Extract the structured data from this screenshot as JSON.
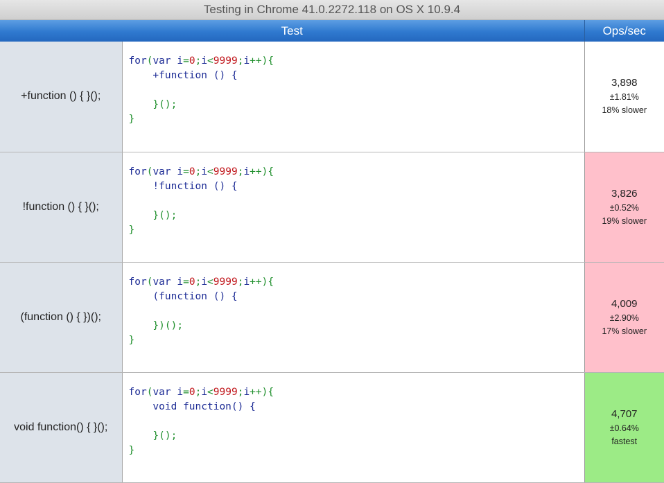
{
  "caption": "Testing in Chrome 41.0.2272.118 on OS X 10.9.4",
  "headers": {
    "test": "Test",
    "ops": "Ops/sec"
  },
  "colors": {
    "slow": "#ffc0cb",
    "fastest": "#9ceb86",
    "neutral": "#ffffff"
  },
  "tests": [
    {
      "title": "+function () { }();",
      "code": {
        "loop": [
          "for",
          "(var i",
          "=",
          "0",
          ";i",
          "<",
          "9999",
          ";i",
          "++",
          "){"
        ],
        "open": "+function () {",
        "close": "}();",
        "end": "}"
      },
      "ops": "3,898",
      "error": "±1.81%",
      "compare": "18% slower",
      "status": "neutral"
    },
    {
      "title": "!function () { }();",
      "code": {
        "open": "!function () {",
        "close": "}();",
        "end": "}"
      },
      "ops": "3,826",
      "error": "±0.52%",
      "compare": "19% slower",
      "status": "slow"
    },
    {
      "title": "(function () { })();",
      "code": {
        "open": "(function () {",
        "close": "})();",
        "end": "}"
      },
      "ops": "4,009",
      "error": "±2.90%",
      "compare": "17% slower",
      "status": "slow"
    },
    {
      "title": "void function() { }();",
      "code": {
        "open": "void function() {",
        "close": "}();",
        "end": "}"
      },
      "ops": "4,707",
      "error": "±0.64%",
      "compare": "fastest",
      "status": "fastest"
    }
  ],
  "loop_parts": {
    "for": "for",
    "var": "var",
    "i": "i",
    "eq": "=",
    "zero": "0",
    "semi1": ";",
    "lt": "<",
    "max": "9999",
    "semi2": ";",
    "inc": "++",
    "tail": "){"
  }
}
